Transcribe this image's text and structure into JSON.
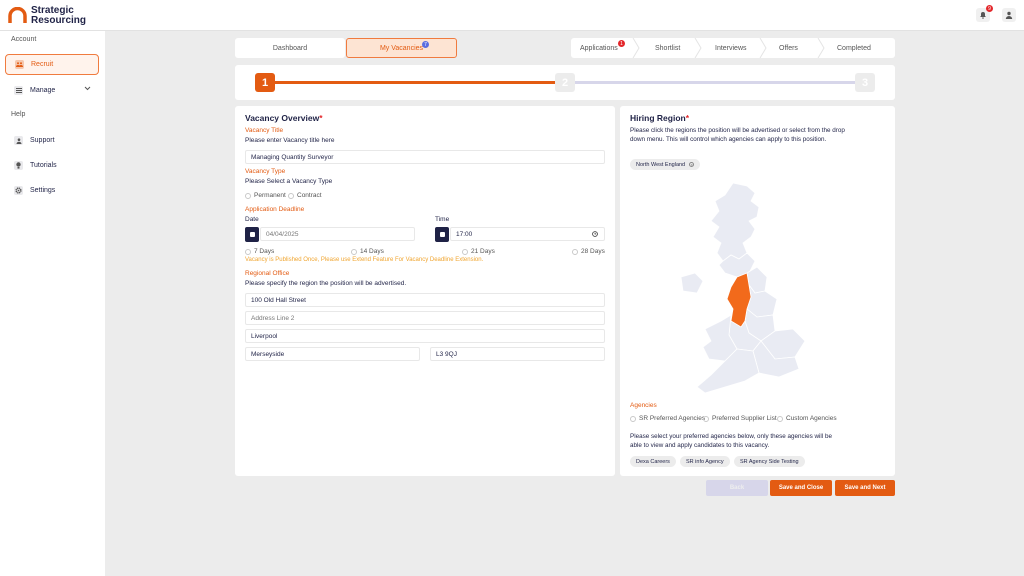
{
  "app": {
    "brand_line1": "Strategic",
    "brand_line2": "Resourcing",
    "notif_count": "9"
  },
  "sidebar": {
    "account_heading": "Account",
    "help_heading": "Help",
    "items": [
      {
        "label": "Recruit",
        "icon": "users-icon"
      },
      {
        "label": "Manage",
        "icon": "list-icon"
      },
      {
        "label": "Support",
        "icon": "person-icon"
      },
      {
        "label": "Tutorials",
        "icon": "bulb-icon"
      },
      {
        "label": "Settings",
        "icon": "gear-icon"
      }
    ]
  },
  "tabs": {
    "dashboard": "Dashboard",
    "my_vacancies": "My Vacancies",
    "my_vacancies_badge": "7"
  },
  "pipeline": {
    "applications": "Applications",
    "applications_badge": "1",
    "shortlist": "Shortlist",
    "interviews": "Interviews",
    "offers": "Offers",
    "completed": "Completed"
  },
  "progress": {
    "steps": [
      "1",
      "2",
      "3"
    ],
    "current": 1,
    "fill_fraction": 0.5
  },
  "overview": {
    "title": "Vacancy Overview",
    "required_mark": "*",
    "vacancy_title_label": "Vacancy Title",
    "vacancy_title_prompt": "Please enter Vacancy title here",
    "vacancy_title_value": "Managing Quantity Surveyor",
    "vacancy_type_label": "Vacancy Type",
    "vacancy_type_prompt": "Please Select a Vacancy Type",
    "type_permanent": "Permanent",
    "type_contract": "Contract",
    "deadline_label": "Application Deadline",
    "date_label": "Date",
    "date_value": "04/04/2025",
    "time_label": "Time",
    "time_value": "17:00",
    "days_7": "7 Days",
    "days_14": "14 Days",
    "days_21": "21 Days",
    "days_28": "28 Days",
    "warning": "Vacancy is Published Once, Please use Extend Feature For Vacancy Deadline Extension.",
    "regional_office_label": "Regional Office",
    "regional_office_prompt": "Please specify the region the position will be advertised.",
    "address1": "100 Old Hall Street",
    "address2_placeholder": "Address Line 2",
    "city": "Liverpool",
    "county": "Merseyside",
    "postcode": "L3 9QJ"
  },
  "region": {
    "title": "Hiring Region",
    "required_mark": "*",
    "description": "Please click the regions the position will be advertised or select from the drop down menu. This will control which agencies can apply to this position.",
    "selected_region": "North West England",
    "highlight_color": "#f26a1b",
    "agencies_label": "Agencies",
    "agency_opt_1": "SR Preferred Agencies",
    "agency_opt_2": "Preferred Supplier List",
    "agency_opt_3": "Custom Agencies",
    "agencies_desc": "Please select your preferred agencies below, only these agencies will be able to view and apply candidates to this vacancy.",
    "agency_chips": [
      "Dexa Careers",
      "SR info Agency",
      "SR Agency Side Testing"
    ]
  },
  "buttons": {
    "back": "Back",
    "save_close": "Save and Close",
    "save_next": "Save and Next"
  }
}
